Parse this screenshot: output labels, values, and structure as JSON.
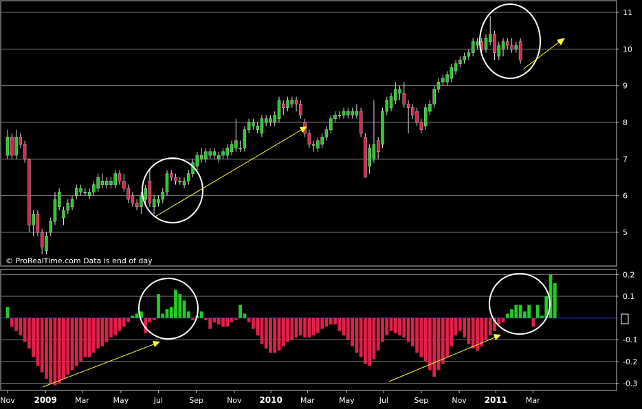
{
  "watermark": "© ProRealTime.com  Data is end of day",
  "colors": {
    "background": "#000000",
    "panel_border": "#c0c0c0",
    "grid": "#7f7f7f",
    "up": "#22cc22",
    "down": "#e0204a",
    "annotation_arrow": "#ffff33",
    "annotation_circle": "#ffffff",
    "zero_line": "#3344ff",
    "axis_text": "#ffffff"
  },
  "x_axis": {
    "labels": [
      {
        "text": "Nov",
        "t": 0
      },
      {
        "text": "2009",
        "t": 8.8
      },
      {
        "text": "Mar",
        "t": 17.3
      },
      {
        "text": "May",
        "t": 26.3
      },
      {
        "text": "Jul",
        "t": 35.0
      },
      {
        "text": "Sep",
        "t": 43.8
      },
      {
        "text": "Nov",
        "t": 52.6
      },
      {
        "text": "2010",
        "t": 61.1
      },
      {
        "text": "Mar",
        "t": 69.6
      },
      {
        "text": "May",
        "t": 78.7
      },
      {
        "text": "Jul",
        "t": 87.3
      },
      {
        "text": "Sep",
        "t": 96.0
      },
      {
        "text": "Nov",
        "t": 104.8
      },
      {
        "text": "2011",
        "t": 113.3
      },
      {
        "text": "Mar",
        "t": 121.9
      }
    ]
  },
  "chart_data": [
    {
      "type": "candlestick",
      "title": "",
      "ylim": [
        4.1,
        11.3
      ],
      "y_ticks": [
        5,
        6,
        7,
        8,
        9,
        10,
        11
      ],
      "grid": true,
      "candles": [
        {
          "o": 7.1,
          "h": 7.8,
          "l": 7.0,
          "c": 7.6
        },
        {
          "o": 7.6,
          "h": 7.7,
          "l": 7.0,
          "c": 7.1
        },
        {
          "o": 7.1,
          "h": 7.8,
          "l": 7.0,
          "c": 7.6
        },
        {
          "o": 7.6,
          "h": 7.7,
          "l": 7.3,
          "c": 7.4
        },
        {
          "o": 7.4,
          "h": 7.5,
          "l": 6.9,
          "c": 7.0
        },
        {
          "o": 7.0,
          "h": 7.0,
          "l": 5.0,
          "c": 5.2
        },
        {
          "o": 5.2,
          "h": 5.6,
          "l": 4.9,
          "c": 5.5
        },
        {
          "o": 5.5,
          "h": 5.6,
          "l": 4.9,
          "c": 5.0
        },
        {
          "o": 5.0,
          "h": 5.1,
          "l": 4.4,
          "c": 4.6
        },
        {
          "o": 4.5,
          "h": 5.0,
          "l": 4.4,
          "c": 4.9
        },
        {
          "o": 5.0,
          "h": 5.4,
          "l": 4.9,
          "c": 5.3
        },
        {
          "o": 5.3,
          "h": 6.1,
          "l": 5.2,
          "c": 5.9
        },
        {
          "o": 5.7,
          "h": 6.2,
          "l": 5.6,
          "c": 6.1
        },
        {
          "o": 5.4,
          "h": 5.7,
          "l": 5.2,
          "c": 5.6
        },
        {
          "o": 5.6,
          "h": 5.9,
          "l": 5.5,
          "c": 5.8
        },
        {
          "o": 5.7,
          "h": 6.0,
          "l": 5.6,
          "c": 5.9
        },
        {
          "o": 6.0,
          "h": 6.3,
          "l": 5.9,
          "c": 6.2
        },
        {
          "o": 6.1,
          "h": 6.3,
          "l": 6.0,
          "c": 6.2
        },
        {
          "o": 6.1,
          "h": 6.2,
          "l": 6.0,
          "c": 6.1
        },
        {
          "o": 6.0,
          "h": 6.2,
          "l": 5.9,
          "c": 6.1
        },
        {
          "o": 6.1,
          "h": 6.4,
          "l": 6.0,
          "c": 6.3
        },
        {
          "o": 6.2,
          "h": 6.6,
          "l": 6.1,
          "c": 6.5
        },
        {
          "o": 6.3,
          "h": 6.6,
          "l": 6.2,
          "c": 6.4
        },
        {
          "o": 6.3,
          "h": 6.5,
          "l": 6.2,
          "c": 6.4
        },
        {
          "o": 6.3,
          "h": 6.5,
          "l": 6.2,
          "c": 6.4
        },
        {
          "o": 6.3,
          "h": 6.7,
          "l": 6.2,
          "c": 6.6
        },
        {
          "o": 6.6,
          "h": 6.7,
          "l": 6.3,
          "c": 6.4
        },
        {
          "o": 6.4,
          "h": 6.6,
          "l": 6.1,
          "c": 6.2
        },
        {
          "o": 6.2,
          "h": 6.3,
          "l": 5.8,
          "c": 5.9
        },
        {
          "o": 6.0,
          "h": 6.1,
          "l": 5.7,
          "c": 5.8
        },
        {
          "o": 5.8,
          "h": 5.9,
          "l": 5.6,
          "c": 5.7
        },
        {
          "o": 5.7,
          "h": 6.1,
          "l": 5.5,
          "c": 6.0
        },
        {
          "o": 5.9,
          "h": 6.3,
          "l": 5.8,
          "c": 6.2
        },
        {
          "o": 6.4,
          "h": 6.7,
          "l": 5.7,
          "c": 5.8
        },
        {
          "o": 5.7,
          "h": 6.0,
          "l": 5.5,
          "c": 5.9
        },
        {
          "o": 5.8,
          "h": 6.0,
          "l": 5.7,
          "c": 5.9
        },
        {
          "o": 5.9,
          "h": 6.2,
          "l": 5.8,
          "c": 6.1
        },
        {
          "o": 6.1,
          "h": 6.7,
          "l": 6.0,
          "c": 6.6
        },
        {
          "o": 6.6,
          "h": 6.7,
          "l": 6.4,
          "c": 6.5
        },
        {
          "o": 6.5,
          "h": 6.6,
          "l": 6.3,
          "c": 6.4
        },
        {
          "o": 6.4,
          "h": 6.5,
          "l": 6.3,
          "c": 6.4
        },
        {
          "o": 6.3,
          "h": 6.5,
          "l": 6.2,
          "c": 6.4
        },
        {
          "o": 6.4,
          "h": 6.7,
          "l": 6.3,
          "c": 6.6
        },
        {
          "o": 6.6,
          "h": 7.0,
          "l": 6.5,
          "c": 6.9
        },
        {
          "o": 6.8,
          "h": 7.2,
          "l": 6.7,
          "c": 7.1
        },
        {
          "o": 7.0,
          "h": 7.3,
          "l": 6.9,
          "c": 7.1
        },
        {
          "o": 7.0,
          "h": 7.3,
          "l": 6.9,
          "c": 7.2
        },
        {
          "o": 7.1,
          "h": 7.3,
          "l": 7.0,
          "c": 7.2
        },
        {
          "o": 7.1,
          "h": 7.3,
          "l": 7.0,
          "c": 7.2
        },
        {
          "o": 7.0,
          "h": 7.2,
          "l": 6.9,
          "c": 7.1
        },
        {
          "o": 7.1,
          "h": 7.3,
          "l": 7.0,
          "c": 7.2
        },
        {
          "o": 7.1,
          "h": 7.4,
          "l": 7.0,
          "c": 7.3
        },
        {
          "o": 7.2,
          "h": 7.5,
          "l": 7.1,
          "c": 7.4
        },
        {
          "o": 7.3,
          "h": 8.1,
          "l": 7.2,
          "c": 7.5
        },
        {
          "o": 7.3,
          "h": 7.5,
          "l": 7.2,
          "c": 7.3
        },
        {
          "o": 7.3,
          "h": 7.9,
          "l": 7.2,
          "c": 7.8
        },
        {
          "o": 7.8,
          "h": 8.1,
          "l": 7.7,
          "c": 8.0
        },
        {
          "o": 7.9,
          "h": 8.1,
          "l": 7.8,
          "c": 8.0
        },
        {
          "o": 7.8,
          "h": 8.0,
          "l": 7.7,
          "c": 7.9
        },
        {
          "o": 7.7,
          "h": 8.2,
          "l": 7.6,
          "c": 8.1
        },
        {
          "o": 8.0,
          "h": 8.2,
          "l": 7.9,
          "c": 8.1
        },
        {
          "o": 8.0,
          "h": 8.2,
          "l": 7.9,
          "c": 8.1
        },
        {
          "o": 8.0,
          "h": 8.3,
          "l": 7.9,
          "c": 8.2
        },
        {
          "o": 8.1,
          "h": 8.7,
          "l": 8.0,
          "c": 8.6
        },
        {
          "o": 8.5,
          "h": 8.6,
          "l": 8.2,
          "c": 8.4
        },
        {
          "o": 8.4,
          "h": 8.7,
          "l": 8.3,
          "c": 8.6
        },
        {
          "o": 8.5,
          "h": 8.7,
          "l": 8.4,
          "c": 8.6
        },
        {
          "o": 8.6,
          "h": 8.7,
          "l": 8.3,
          "c": 8.5
        },
        {
          "o": 8.5,
          "h": 8.6,
          "l": 8.1,
          "c": 8.2
        },
        {
          "o": 8.0,
          "h": 8.1,
          "l": 7.6,
          "c": 7.7
        },
        {
          "o": 7.7,
          "h": 7.8,
          "l": 7.3,
          "c": 7.4
        },
        {
          "o": 7.4,
          "h": 7.5,
          "l": 7.2,
          "c": 7.4
        },
        {
          "o": 7.3,
          "h": 7.6,
          "l": 7.2,
          "c": 7.5
        },
        {
          "o": 7.4,
          "h": 7.7,
          "l": 7.3,
          "c": 7.6
        },
        {
          "o": 7.6,
          "h": 7.9,
          "l": 7.5,
          "c": 7.8
        },
        {
          "o": 7.8,
          "h": 8.2,
          "l": 7.7,
          "c": 8.1
        },
        {
          "o": 8.1,
          "h": 8.3,
          "l": 8.0,
          "c": 8.2
        },
        {
          "o": 8.2,
          "h": 8.3,
          "l": 8.1,
          "c": 8.2
        },
        {
          "o": 8.2,
          "h": 8.4,
          "l": 8.1,
          "c": 8.3
        },
        {
          "o": 8.2,
          "h": 8.4,
          "l": 8.1,
          "c": 8.3
        },
        {
          "o": 8.2,
          "h": 8.4,
          "l": 8.1,
          "c": 8.3
        },
        {
          "o": 8.2,
          "h": 8.5,
          "l": 8.1,
          "c": 8.3
        },
        {
          "o": 8.3,
          "h": 8.4,
          "l": 7.6,
          "c": 7.7
        },
        {
          "o": 7.6,
          "h": 7.7,
          "l": 6.5,
          "c": 6.5
        },
        {
          "o": 6.8,
          "h": 7.4,
          "l": 6.6,
          "c": 7.3
        },
        {
          "o": 7.0,
          "h": 8.6,
          "l": 6.9,
          "c": 7.4
        },
        {
          "o": 7.5,
          "h": 7.6,
          "l": 7.0,
          "c": 7.2
        },
        {
          "o": 7.4,
          "h": 8.4,
          "l": 7.3,
          "c": 8.3
        },
        {
          "o": 8.3,
          "h": 8.7,
          "l": 8.2,
          "c": 8.6
        },
        {
          "o": 8.4,
          "h": 8.8,
          "l": 8.3,
          "c": 8.7
        },
        {
          "o": 8.6,
          "h": 9.1,
          "l": 8.5,
          "c": 8.9
        },
        {
          "o": 8.8,
          "h": 9.0,
          "l": 8.6,
          "c": 8.9
        },
        {
          "o": 8.8,
          "h": 9.1,
          "l": 8.4,
          "c": 8.5
        },
        {
          "o": 8.5,
          "h": 8.6,
          "l": 7.7,
          "c": 8.4
        },
        {
          "o": 8.4,
          "h": 8.5,
          "l": 8.1,
          "c": 8.2
        },
        {
          "o": 8.3,
          "h": 8.4,
          "l": 7.9,
          "c": 8.0
        },
        {
          "o": 8.0,
          "h": 8.1,
          "l": 7.7,
          "c": 7.8
        },
        {
          "o": 7.9,
          "h": 8.5,
          "l": 7.8,
          "c": 8.4
        },
        {
          "o": 8.3,
          "h": 8.6,
          "l": 8.2,
          "c": 8.5
        },
        {
          "o": 8.5,
          "h": 9.0,
          "l": 8.4,
          "c": 8.9
        },
        {
          "o": 8.9,
          "h": 9.2,
          "l": 8.8,
          "c": 9.1
        },
        {
          "o": 9.1,
          "h": 9.3,
          "l": 9.0,
          "c": 9.2
        },
        {
          "o": 9.1,
          "h": 9.4,
          "l": 9.0,
          "c": 9.3
        },
        {
          "o": 9.2,
          "h": 9.6,
          "l": 9.1,
          "c": 9.5
        },
        {
          "o": 9.4,
          "h": 9.7,
          "l": 9.3,
          "c": 9.6
        },
        {
          "o": 9.6,
          "h": 9.8,
          "l": 9.5,
          "c": 9.7
        },
        {
          "o": 9.7,
          "h": 9.9,
          "l": 9.6,
          "c": 9.8
        },
        {
          "o": 9.8,
          "h": 10.0,
          "l": 9.7,
          "c": 9.9
        },
        {
          "o": 9.9,
          "h": 10.3,
          "l": 9.8,
          "c": 10.2
        },
        {
          "o": 10.1,
          "h": 10.3,
          "l": 10.0,
          "c": 10.2
        },
        {
          "o": 10.2,
          "h": 10.3,
          "l": 9.9,
          "c": 10.0
        },
        {
          "o": 10.0,
          "h": 10.4,
          "l": 9.9,
          "c": 10.3
        },
        {
          "o": 10.2,
          "h": 10.9,
          "l": 10.1,
          "c": 10.4
        },
        {
          "o": 10.4,
          "h": 10.5,
          "l": 9.7,
          "c": 9.9
        },
        {
          "o": 9.8,
          "h": 10.2,
          "l": 9.7,
          "c": 10.1
        },
        {
          "o": 10.0,
          "h": 10.3,
          "l": 9.8,
          "c": 10.2
        },
        {
          "o": 10.2,
          "h": 10.3,
          "l": 10.0,
          "c": 10.1
        },
        {
          "o": 10.1,
          "h": 10.3,
          "l": 9.9,
          "c": 10.0
        },
        {
          "o": 10.0,
          "h": 10.2,
          "l": 9.9,
          "c": 10.1
        },
        {
          "o": 10.2,
          "h": 10.3,
          "l": 9.6,
          "c": 9.7
        }
      ]
    },
    {
      "type": "bar",
      "title": "",
      "ylim": [
        -0.33,
        0.22
      ],
      "y_ticks": [
        0.2,
        0.1,
        0,
        -0.1,
        -0.2,
        -0.3
      ],
      "y_tick_labels": [
        "0.2",
        "0.1",
        "0",
        "-0.1",
        "-0.2",
        "-0.3"
      ],
      "grid": true,
      "values": [
        0.05,
        -0.04,
        -0.06,
        -0.08,
        -0.11,
        -0.14,
        -0.18,
        -0.22,
        -0.25,
        -0.28,
        -0.3,
        -0.31,
        -0.3,
        -0.28,
        -0.26,
        -0.24,
        -0.22,
        -0.2,
        -0.18,
        -0.18,
        -0.16,
        -0.14,
        -0.13,
        -0.11,
        -0.09,
        -0.08,
        -0.06,
        -0.04,
        -0.02,
        0.01,
        0.02,
        0.03,
        -0.07,
        -0.02,
        -0.01,
        0.11,
        0.02,
        0.04,
        0.05,
        0.13,
        0.11,
        0.08,
        0.03,
        -0.01,
        0.01,
        0.03,
        -0.01,
        -0.05,
        -0.02,
        -0.03,
        -0.04,
        -0.04,
        -0.02,
        -0.01,
        0.06,
        0.02,
        -0.02,
        -0.05,
        -0.08,
        -0.12,
        -0.14,
        -0.16,
        -0.16,
        -0.15,
        -0.13,
        -0.11,
        -0.1,
        -0.09,
        -0.08,
        -0.09,
        -0.09,
        -0.08,
        -0.07,
        -0.05,
        -0.04,
        -0.03,
        -0.03,
        -0.06,
        -0.08,
        -0.1,
        -0.13,
        -0.16,
        -0.18,
        -0.21,
        -0.22,
        -0.19,
        -0.15,
        -0.11,
        -0.08,
        -0.06,
        -0.07,
        -0.08,
        -0.09,
        -0.11,
        -0.13,
        -0.16,
        -0.18,
        -0.2,
        -0.24,
        -0.27,
        -0.24,
        -0.21,
        -0.18,
        -0.13,
        -0.08,
        -0.06,
        -0.09,
        -0.12,
        -0.14,
        -0.15,
        -0.13,
        -0.1,
        -0.08,
        -0.06,
        -0.03,
        -0.02,
        0.02,
        0.04,
        0.06,
        0.06,
        0.03,
        0.06,
        -0.04,
        0.06,
        0.01,
        0.1,
        0.2,
        0.16
      ]
    }
  ]
}
